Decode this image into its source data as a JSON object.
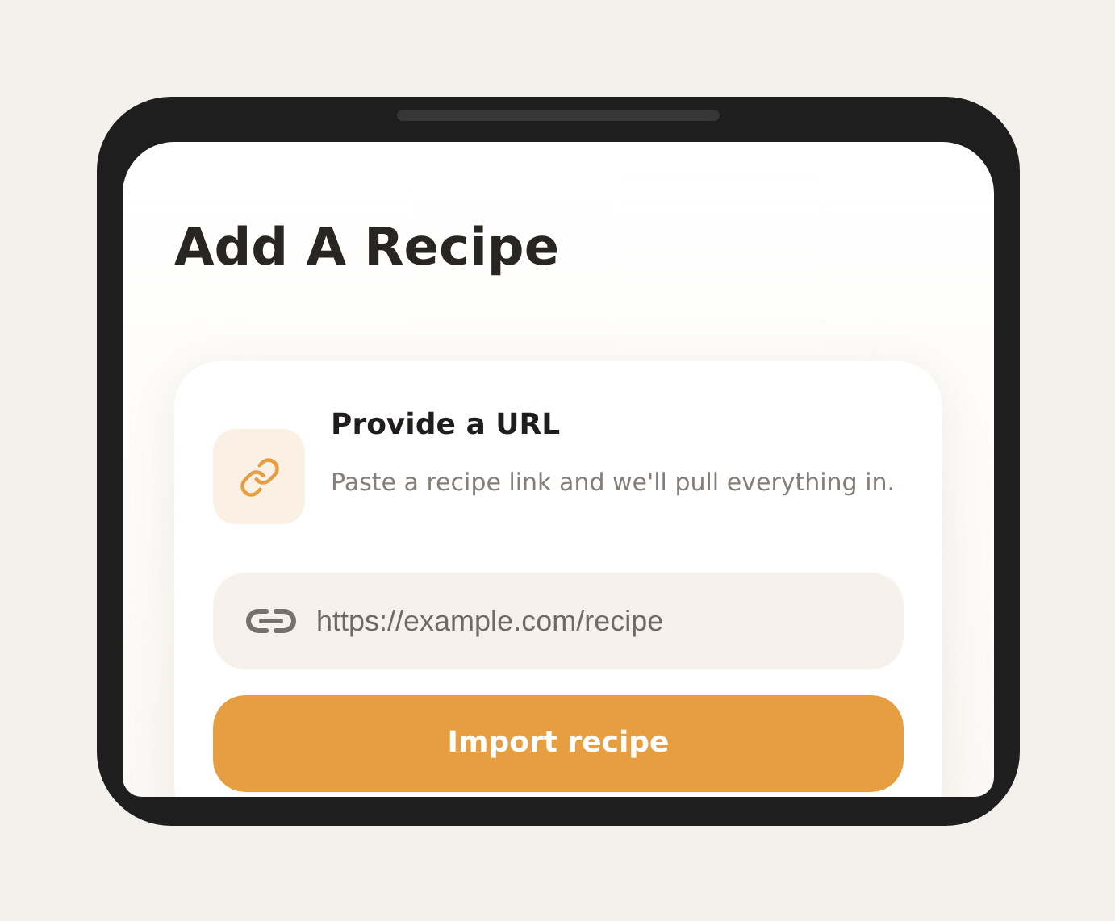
{
  "page": {
    "title": "Add A Recipe"
  },
  "card": {
    "heading": "Provide a URL",
    "description": "Paste a recipe link and we'll pull everything in.",
    "url_field": {
      "placeholder": "https://example.com/recipe"
    },
    "button": "Import recipe"
  }
}
